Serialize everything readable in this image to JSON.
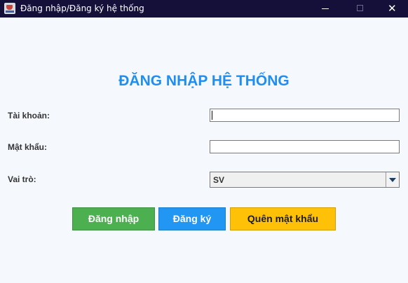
{
  "window": {
    "title": "Đăng nhập/Đăng ký hệ thống",
    "close_glyph": "✕"
  },
  "form": {
    "heading": "ĐĂNG NHẬP HỆ THỐNG",
    "account_label": "Tài khoản:",
    "account_value": "",
    "password_label": "Mật khẩu:",
    "password_value": "",
    "role_label": "Vai trò:",
    "role_selected": "SV"
  },
  "buttons": {
    "login": "Đăng nhập",
    "register": "Đăng ký",
    "forgot": "Quên mật khẩu"
  },
  "colors": {
    "title_bar": "#15103a",
    "heading": "#1f8ef0",
    "login_button": "#4caf50",
    "register_button": "#2196f3",
    "forgot_button": "#ffc107"
  },
  "icons": {
    "app": "coffee-cup-icon",
    "minimize": "minimize-icon",
    "maximize": "maximize-icon",
    "close": "close-icon",
    "dropdown": "chevron-down-icon"
  }
}
